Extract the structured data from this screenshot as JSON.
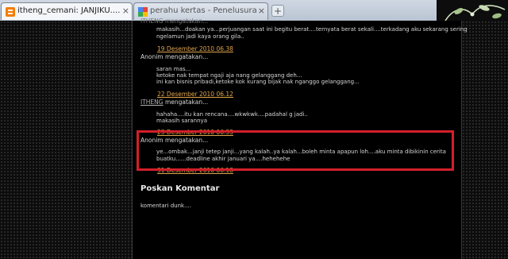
{
  "browser": {
    "tabs": [
      {
        "title": "itheng_cemani: JANJIKU....!!!!!MU...",
        "active": true
      },
      {
        "title": "perahu kertas - Penelusuran Google",
        "active": false
      }
    ],
    "new_tab_symbol": "+",
    "close_symbol": "×"
  },
  "comments": {
    "top_cut_author": "ITHENG mengatakan...",
    "c1_lines": [
      "makasih...doakan ya...perjuangan saat ini begitu berat....ternyata berat sekali....terkadang aku sekarang sering",
      "ngelamun jadi kaya orang gila.."
    ],
    "c2_time": "19 Desember 2010 06.38",
    "c2_author": "Anonim mengatakan...",
    "c2_lines": [
      "saran mas...",
      "ketoke nak tempat ngaji aja nang gelanggang deh...",
      "ini kan bisnis pribadi,ketoke kok kurang bijak nak nganggo gelanggang..."
    ],
    "c3_time": "22 Desember 2010 06.12",
    "c3_author_name": "ITHENG",
    "c3_author_suffix": " mengatakan...",
    "c3_lines": [
      "hahaha....itu kan rencana....wkwkwk....padahal g jadi..",
      "makasih sarannya"
    ],
    "c4_time": "23 Desember 2010 06.33",
    "c4_author": "Anonim mengatakan...",
    "c4_lines": [
      "ye...ombak...janji tetep janji...yang kalah..ya kalah...boleh minta apapun loh....aku minta dibikinin cerita",
      "buatku......deadline akhir januari ya....hehehehe"
    ],
    "c5_time": "31 Desember 2010 06.18"
  },
  "post_comment": {
    "heading": "Poskan Komentar",
    "text": "komentari dunk...."
  },
  "colors": {
    "highlight": "#d21f2a",
    "timestamp": "#e0a44a"
  }
}
